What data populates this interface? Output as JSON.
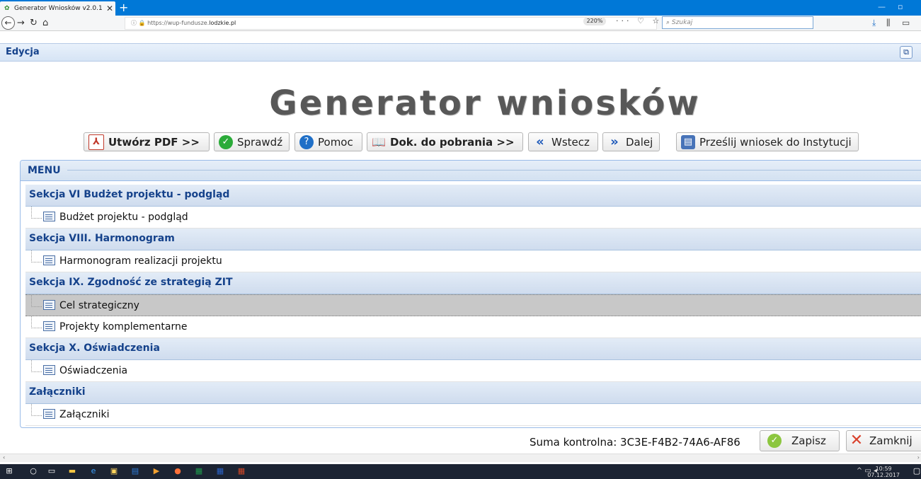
{
  "browser": {
    "tab_title": "Generator Wniosków v2.0.1",
    "tab_close": "✕",
    "new_tab": "+",
    "url_scheme": "https://wup-fundusze.",
    "url_domain": "lodzkie.pl",
    "zoom": "220%",
    "search_placeholder": "Szukaj",
    "page_actions": "··· ♡ ☆"
  },
  "app": {
    "panel_title": "Edycja",
    "heading": "Generator wniosków",
    "toolbar": {
      "pdf": "Utwórz PDF >>",
      "check": "Sprawdź",
      "help": "Pomoc",
      "docs": "Dok. do pobrania >>",
      "back": "Wstecz",
      "next": "Dalej",
      "submit": "Prześlij wniosek do Instytucji"
    },
    "menu_title": "MENU",
    "menu": [
      {
        "type": "section",
        "label": "Sekcja VI Budżet projektu - podgląd"
      },
      {
        "type": "item",
        "label": "Budżet projektu - podgląd"
      },
      {
        "type": "section",
        "label": "Sekcja VIII. Harmonogram"
      },
      {
        "type": "item",
        "label": "Harmonogram realizacji projektu"
      },
      {
        "type": "section",
        "label": "Sekcja IX. Zgodność ze strategią ZIT"
      },
      {
        "type": "item",
        "label": "Cel strategiczny",
        "selected": true
      },
      {
        "type": "item",
        "label": "Projekty komplementarne"
      },
      {
        "type": "section",
        "label": "Sekcja X. Oświadczenia"
      },
      {
        "type": "item",
        "label": "Oświadczenia"
      },
      {
        "type": "section",
        "label": "Załączniki"
      },
      {
        "type": "item",
        "label": "Załączniki"
      }
    ],
    "checksum_label": "Suma kontrolna: 3C3E-F4B2-74A6-AF86",
    "save": "Zapisz",
    "close": "Zamknij"
  },
  "taskbar": {
    "time": "10:59",
    "date": "07.12.2017"
  },
  "colors": {
    "accent": "#15428b",
    "tabbar": "#0078d7",
    "taskbar": "#1c2433"
  }
}
